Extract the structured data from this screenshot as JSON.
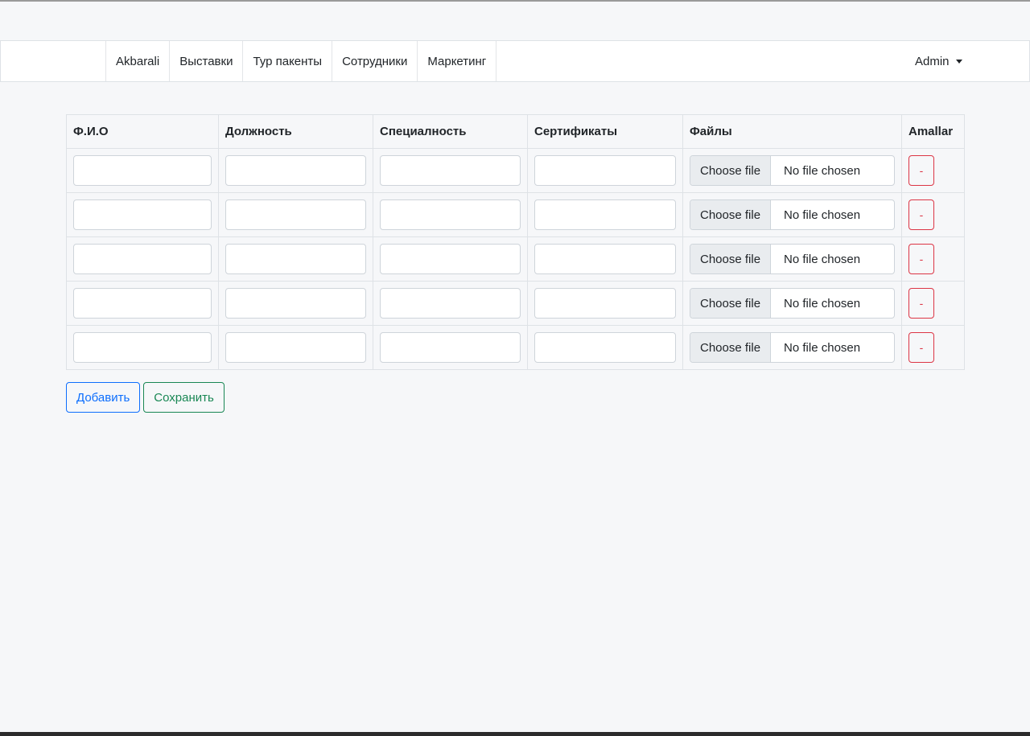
{
  "nav": {
    "items": [
      {
        "label": "Akbarali"
      },
      {
        "label": "Выставки"
      },
      {
        "label": "Тур пакенты"
      },
      {
        "label": "Сотрудники"
      },
      {
        "label": "Маркетинг"
      }
    ],
    "user_label": "Admin"
  },
  "table": {
    "headers": [
      "Ф.И.О",
      "Должность",
      "Специалность",
      "Сертификаты",
      "Файлы",
      "Amallar"
    ],
    "file_button_label": "Choose file",
    "file_status": "No file chosen",
    "remove_label": "-",
    "row_count": 5
  },
  "actions": {
    "add_label": "Добавить",
    "save_label": "Сохранить"
  },
  "colors": {
    "primary": "#0d6efd",
    "success": "#198754",
    "danger": "#dc3545",
    "background": "#f6f7f9"
  }
}
